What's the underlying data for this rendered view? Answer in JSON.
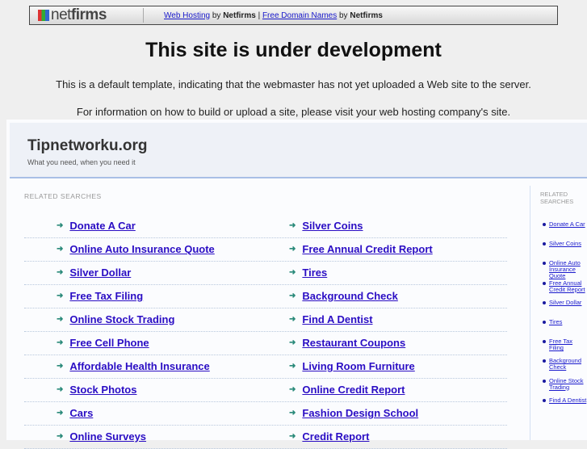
{
  "topbar": {
    "logo": "netfirms",
    "link1": "Web Hosting",
    "by1": "by",
    "brand1": "Netfirms",
    "sep": "|",
    "link2": "Free Domain Names",
    "by2": "by",
    "brand2": "Netfirms"
  },
  "title": "This site is under development",
  "message1": "This is a default template, indicating that the webmaster has not yet uploaded a Web site to the server.",
  "message2": "For information on how to build or upload a site, please visit your web hosting company's site.",
  "site": {
    "name": "Tipnetworku.org",
    "tagline": "What you need, when you need it"
  },
  "main": {
    "heading": "RELATED SEARCHES",
    "left": [
      "Donate A Car",
      "Online Auto Insurance Quote",
      "Silver Dollar",
      "Free Tax Filing",
      "Online Stock Trading",
      "Free Cell Phone",
      "Affordable Health Insurance",
      "Stock Photos",
      "Cars",
      "Online Surveys"
    ],
    "right": [
      "Silver Coins",
      "Free Annual Credit Report",
      "Tires",
      "Background Check",
      "Find A Dentist",
      "Restaurant Coupons",
      "Living Room Furniture",
      "Online Credit Report",
      "Fashion Design School",
      "Credit Report"
    ]
  },
  "side": {
    "heading": "RELATED SEARCHES",
    "items": [
      "Donate A Car",
      "Silver Coins",
      "Online Auto Insurance Quote",
      "Free Annual Credit Report",
      "Silver Dollar",
      "Tires",
      "Free Tax Filing",
      "Background Check",
      "Online Stock Trading",
      "Find A Dentist"
    ]
  },
  "colors": {
    "link": "#2a0dc4",
    "arrow": "#2a8a7a",
    "header_line": "#a9bfe6"
  }
}
